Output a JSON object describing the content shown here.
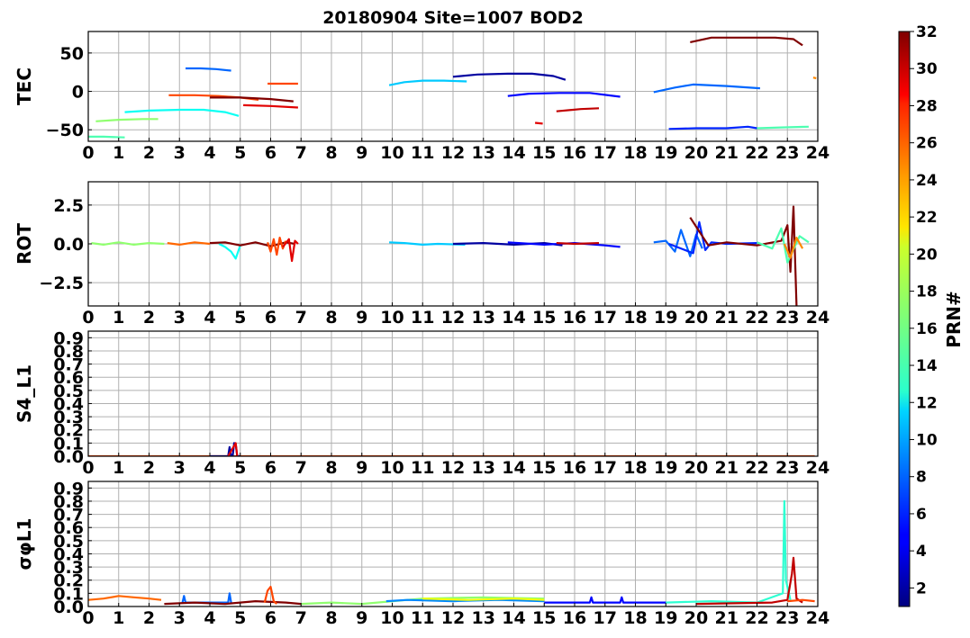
{
  "figure": {
    "title": "20180904 Site=1007 BOD2"
  },
  "colors": {
    "grid": "#b0b0b0",
    "colormap": "jet"
  },
  "colorbar": {
    "label": "PRN#",
    "range": [
      1,
      32
    ],
    "ticks": [
      2,
      4,
      6,
      8,
      10,
      12,
      14,
      16,
      18,
      20,
      22,
      24,
      26,
      28,
      30,
      32
    ],
    "tick_labels": [
      "2",
      "4",
      "6",
      "8",
      "10",
      "12",
      "14",
      "16",
      "18",
      "20",
      "22",
      "24",
      "26",
      "28",
      "30",
      "32"
    ]
  },
  "chart_data": [
    {
      "type": "line",
      "panel": "TEC",
      "ylabel": "TEC",
      "xlim": [
        0,
        24
      ],
      "ylim": [
        -65,
        78
      ],
      "xticks": [
        0,
        1,
        2,
        3,
        4,
        5,
        6,
        7,
        8,
        9,
        10,
        11,
        12,
        13,
        14,
        15,
        16,
        17,
        18,
        19,
        20,
        21,
        22,
        23,
        24
      ],
      "xtick_labels": [
        "0",
        "1",
        "2",
        "3",
        "4",
        "5",
        "6",
        "7",
        "8",
        "9",
        "10",
        "11",
        "12",
        "13",
        "14",
        "15",
        "16",
        "17",
        "18",
        "19",
        "20",
        "21",
        "22",
        "23",
        "24"
      ],
      "yticks": [
        -50,
        0,
        50
      ],
      "ytick_labels": [
        "−50",
        "0",
        "50"
      ],
      "grid": true,
      "series": [
        {
          "prn": 15,
          "x": [
            0.0,
            0.5,
            1.2
          ],
          "y": [
            -59,
            -59,
            -60
          ]
        },
        {
          "prn": 17,
          "x": [
            0.25,
            1.0,
            1.8,
            2.3
          ],
          "y": [
            -39,
            -37,
            -36,
            -36
          ]
        },
        {
          "prn": 13,
          "x": [
            1.2,
            2.0,
            3.0,
            3.8,
            4.5,
            4.95
          ],
          "y": [
            -27,
            -25,
            -24,
            -24,
            -27,
            -32
          ]
        },
        {
          "prn": 8,
          "x": [
            3.2,
            3.7,
            4.2,
            4.7
          ],
          "y": [
            30,
            30,
            29,
            27
          ]
        },
        {
          "prn": 26,
          "x": [
            2.65,
            3.5,
            4.3,
            5.0,
            5.6
          ],
          "y": [
            -5,
            -5,
            -6,
            -8,
            -11
          ]
        },
        {
          "prn": 32,
          "x": [
            4.0,
            5.0,
            6.0,
            6.75
          ],
          "y": [
            -8,
            -8,
            -10,
            -13
          ]
        },
        {
          "prn": 29,
          "x": [
            5.1,
            6.0,
            6.9
          ],
          "y": [
            -18,
            -19,
            -21
          ]
        },
        {
          "prn": 26,
          "x": [
            5.9,
            6.4,
            6.9
          ],
          "y": [
            10,
            10,
            10
          ]
        },
        {
          "prn": 11,
          "x": [
            9.9,
            10.4,
            11.0,
            11.7,
            12.45
          ],
          "y": [
            8,
            12,
            14,
            14,
            13
          ]
        },
        {
          "prn": 2,
          "x": [
            12.0,
            12.8,
            13.8,
            14.6,
            15.3,
            15.7
          ],
          "y": [
            19,
            22,
            23,
            23,
            20,
            15
          ]
        },
        {
          "prn": 5,
          "x": [
            13.8,
            14.5,
            15.5,
            16.5,
            17.5
          ],
          "y": [
            -6,
            -3,
            -2,
            -2,
            -7
          ]
        },
        {
          "prn": 29,
          "x": [
            14.7,
            14.95
          ],
          "y": [
            -41,
            -42
          ]
        },
        {
          "prn": 30,
          "x": [
            15.4,
            16.2,
            16.8
          ],
          "y": [
            -26,
            -23,
            -22
          ]
        },
        {
          "prn": 8,
          "x": [
            18.6,
            19.3,
            19.9,
            21.0,
            22.1
          ],
          "y": [
            -1,
            5,
            9,
            7,
            4
          ]
        },
        {
          "prn": 6,
          "x": [
            19.1,
            20.0,
            21.0,
            21.7,
            22.0
          ],
          "y": [
            -49,
            -48,
            -48,
            -46,
            -48
          ]
        },
        {
          "prn": 32,
          "x": [
            19.8,
            20.5,
            21.5,
            22.6,
            23.2,
            23.5
          ],
          "y": [
            64,
            70,
            70,
            70,
            68,
            60
          ]
        },
        {
          "prn": 15,
          "x": [
            22.0,
            22.8,
            23.7
          ],
          "y": [
            -48,
            -47,
            -46
          ]
        },
        {
          "prn": 24,
          "x": [
            23.85,
            23.95
          ],
          "y": [
            18,
            17
          ]
        }
      ]
    },
    {
      "type": "line",
      "panel": "ROT",
      "ylabel": "ROT",
      "xlim": [
        0,
        24
      ],
      "ylim": [
        -4,
        4
      ],
      "xticks": [
        0,
        1,
        2,
        3,
        4,
        5,
        6,
        7,
        8,
        9,
        10,
        11,
        12,
        13,
        14,
        15,
        16,
        17,
        18,
        19,
        20,
        21,
        22,
        23,
        24
      ],
      "xtick_labels": [
        "0",
        "1",
        "2",
        "3",
        "4",
        "5",
        "6",
        "7",
        "8",
        "9",
        "10",
        "11",
        "12",
        "13",
        "14",
        "15",
        "16",
        "17",
        "18",
        "19",
        "20",
        "21",
        "22",
        "23",
        "24"
      ],
      "yticks": [
        -2.5,
        0.0,
        2.5
      ],
      "ytick_labels": [
        "−2.5",
        "0.0",
        "2.5"
      ],
      "grid": true,
      "series": [
        {
          "prn": 17,
          "x": [
            0.1,
            0.5,
            1.0,
            1.5,
            2.0,
            2.5
          ],
          "y": [
            0.05,
            -0.05,
            0.1,
            -0.05,
            0.05,
            0.0
          ]
        },
        {
          "prn": 25,
          "x": [
            2.6,
            3.0,
            3.5,
            4.0
          ],
          "y": [
            0.05,
            -0.05,
            0.1,
            0.0
          ]
        },
        {
          "prn": 13,
          "x": [
            4.3,
            4.5,
            4.7,
            4.85,
            5.0
          ],
          "y": [
            0.0,
            -0.2,
            -0.5,
            -0.95,
            -0.1
          ]
        },
        {
          "prn": 32,
          "x": [
            4.0,
            4.5,
            5.0,
            5.5,
            6.0,
            6.5,
            6.8
          ],
          "y": [
            0.05,
            0.1,
            -0.1,
            0.1,
            -0.15,
            0.1,
            0.0
          ]
        },
        {
          "prn": 26,
          "x": [
            5.9,
            6.0,
            6.1,
            6.2,
            6.3,
            6.4,
            6.5
          ],
          "y": [
            0.1,
            -0.5,
            0.3,
            -0.7,
            0.4,
            -0.3,
            0.2
          ]
        },
        {
          "prn": 29,
          "x": [
            6.4,
            6.6,
            6.7,
            6.8,
            6.9
          ],
          "y": [
            -0.2,
            0.3,
            -1.1,
            0.2,
            0.0
          ]
        },
        {
          "prn": 11,
          "x": [
            9.9,
            10.4,
            11.0,
            11.5,
            12.4
          ],
          "y": [
            0.1,
            0.05,
            -0.05,
            0.0,
            -0.05
          ]
        },
        {
          "prn": 2,
          "x": [
            12.0,
            13.0,
            14.0,
            15.0,
            15.6
          ],
          "y": [
            0.0,
            0.05,
            -0.05,
            0.05,
            -0.1
          ]
        },
        {
          "prn": 5,
          "x": [
            13.8,
            15.0,
            16.0,
            17.0,
            17.5
          ],
          "y": [
            0.1,
            -0.05,
            0.05,
            -0.1,
            -0.2
          ]
        },
        {
          "prn": 30,
          "x": [
            15.4,
            16.0,
            16.8
          ],
          "y": [
            0.05,
            0.0,
            0.05
          ]
        },
        {
          "prn": 8,
          "x": [
            18.6,
            19.0,
            19.3,
            19.5,
            19.8,
            20.0,
            20.2
          ],
          "y": [
            0.1,
            0.2,
            -0.5,
            0.9,
            -0.8,
            0.6,
            -0.3
          ]
        },
        {
          "prn": 6,
          "x": [
            19.1,
            19.9,
            20.1,
            20.3,
            20.5,
            21.0,
            22.0
          ],
          "y": [
            0.0,
            -0.6,
            1.4,
            -0.4,
            0.1,
            0.0,
            0.05
          ]
        },
        {
          "prn": 32,
          "x": [
            19.8,
            20.4,
            21.0,
            22.0,
            22.8,
            23.0,
            23.1,
            23.2,
            23.3
          ],
          "y": [
            1.7,
            -0.1,
            0.1,
            -0.1,
            0.2,
            1.2,
            -1.8,
            2.4,
            -4.0
          ]
        },
        {
          "prn": 15,
          "x": [
            22.0,
            22.5,
            22.8,
            23.0,
            23.4,
            23.7
          ],
          "y": [
            0.1,
            -0.3,
            1.0,
            -1.2,
            0.5,
            0.1
          ]
        },
        {
          "prn": 24,
          "x": [
            22.9,
            23.1,
            23.3,
            23.5
          ],
          "y": [
            0.0,
            -0.9,
            0.4,
            -0.3
          ]
        }
      ]
    },
    {
      "type": "line",
      "panel": "S4_L1",
      "ylabel": "S4_L1",
      "xlim": [
        0,
        24
      ],
      "ylim": [
        0,
        0.95
      ],
      "xticks": [
        0,
        1,
        2,
        3,
        4,
        5,
        6,
        7,
        8,
        9,
        10,
        11,
        12,
        13,
        14,
        15,
        16,
        17,
        18,
        19,
        20,
        21,
        22,
        23,
        24
      ],
      "xtick_labels": [
        "0",
        "1",
        "2",
        "3",
        "4",
        "5",
        "6",
        "7",
        "8",
        "9",
        "10",
        "11",
        "12",
        "13",
        "14",
        "15",
        "16",
        "17",
        "18",
        "19",
        "20",
        "21",
        "22",
        "23",
        "24"
      ],
      "yticks": [
        0.0,
        0.1,
        0.2,
        0.3,
        0.4,
        0.5,
        0.6,
        0.7,
        0.8,
        0.9
      ],
      "ytick_labels": [
        "0.0",
        "0.1",
        "0.2",
        "0.3",
        "0.4",
        "0.5",
        "0.6",
        "0.7",
        "0.8",
        "0.9"
      ],
      "grid": true,
      "series": [
        {
          "prn": 26,
          "x": [
            0.0,
            4.0,
            8.0,
            12.0,
            16.0,
            20.0,
            23.9
          ],
          "y": [
            0.0,
            0.0,
            0.0,
            0.0,
            0.0,
            0.0,
            0.0
          ]
        },
        {
          "prn": 2,
          "x": [
            4.0,
            4.6,
            4.65,
            4.7,
            4.75,
            4.8,
            4.85,
            4.9,
            5.0
          ],
          "y": [
            0.0,
            0.0,
            0.07,
            0.0,
            0.0,
            0.1,
            0.09,
            0.0,
            0.0
          ]
        },
        {
          "prn": 29,
          "x": [
            4.6,
            4.8,
            4.85,
            4.9
          ],
          "y": [
            0.0,
            0.08,
            0.1,
            0.0
          ]
        }
      ]
    },
    {
      "type": "line",
      "panel": "sigma_phi_L1",
      "ylabel": "σφL1",
      "xlim": [
        0,
        24
      ],
      "ylim": [
        0,
        0.95
      ],
      "xticks": [
        0,
        1,
        2,
        3,
        4,
        5,
        6,
        7,
        8,
        9,
        10,
        11,
        12,
        13,
        14,
        15,
        16,
        17,
        18,
        19,
        20,
        21,
        22,
        23,
        24
      ],
      "xtick_labels": [
        "0",
        "1",
        "2",
        "3",
        "4",
        "5",
        "6",
        "7",
        "8",
        "9",
        "10",
        "11",
        "12",
        "13",
        "14",
        "15",
        "16",
        "17",
        "18",
        "19",
        "20",
        "21",
        "22",
        "23",
        "24"
      ],
      "yticks": [
        0.0,
        0.1,
        0.2,
        0.3,
        0.4,
        0.5,
        0.6,
        0.7,
        0.8,
        0.9
      ],
      "ytick_labels": [
        "0.0",
        "0.1",
        "0.2",
        "0.3",
        "0.4",
        "0.5",
        "0.6",
        "0.7",
        "0.8",
        "0.9"
      ],
      "grid": true,
      "series": [
        {
          "prn": 25,
          "x": [
            0.0,
            0.5,
            1.0,
            1.5,
            2.0,
            2.4
          ],
          "y": [
            0.05,
            0.06,
            0.08,
            0.07,
            0.06,
            0.05
          ]
        },
        {
          "prn": 8,
          "x": [
            3.1,
            3.15,
            3.2,
            4.6,
            4.65,
            4.7
          ],
          "y": [
            0.03,
            0.08,
            0.03,
            0.03,
            0.1,
            0.03
          ]
        },
        {
          "prn": 32,
          "x": [
            2.5,
            3.5,
            4.5,
            5.5,
            6.5,
            7.0
          ],
          "y": [
            0.02,
            0.03,
            0.02,
            0.04,
            0.03,
            0.02
          ]
        },
        {
          "prn": 26,
          "x": [
            5.8,
            5.9,
            6.0,
            6.1,
            6.2
          ],
          "y": [
            0.03,
            0.12,
            0.15,
            0.04,
            0.02
          ]
        },
        {
          "prn": 17,
          "x": [
            7.0,
            8.0,
            9.0,
            11.0,
            13.0,
            15.0
          ],
          "y": [
            0.02,
            0.03,
            0.02,
            0.06,
            0.07,
            0.06
          ]
        },
        {
          "prn": 9,
          "x": [
            9.8,
            10.5,
            12.0,
            13.5,
            15.0
          ],
          "y": [
            0.04,
            0.05,
            0.04,
            0.05,
            0.04
          ]
        },
        {
          "prn": 20,
          "x": [
            11.0,
            12.5,
            14.0,
            15.0
          ],
          "y": [
            0.06,
            0.05,
            0.06,
            0.05
          ]
        },
        {
          "prn": 5,
          "x": [
            15.0,
            16.5,
            16.55,
            16.6,
            17.5,
            17.55,
            17.6,
            19.0
          ],
          "y": [
            0.03,
            0.03,
            0.07,
            0.03,
            0.03,
            0.07,
            0.03,
            0.03
          ]
        },
        {
          "prn": 14,
          "x": [
            19.0,
            20.5,
            22.0,
            22.85,
            22.9,
            22.95,
            23.1
          ],
          "y": [
            0.03,
            0.04,
            0.03,
            0.1,
            0.8,
            0.2,
            0.05
          ]
        },
        {
          "prn": 30,
          "x": [
            20.0,
            22.5,
            23.0,
            23.15,
            23.2,
            23.3,
            23.5
          ],
          "y": [
            0.02,
            0.03,
            0.05,
            0.25,
            0.37,
            0.06,
            0.03
          ]
        },
        {
          "prn": 26,
          "x": [
            23.0,
            23.5,
            23.9
          ],
          "y": [
            0.04,
            0.05,
            0.04
          ]
        }
      ]
    }
  ]
}
